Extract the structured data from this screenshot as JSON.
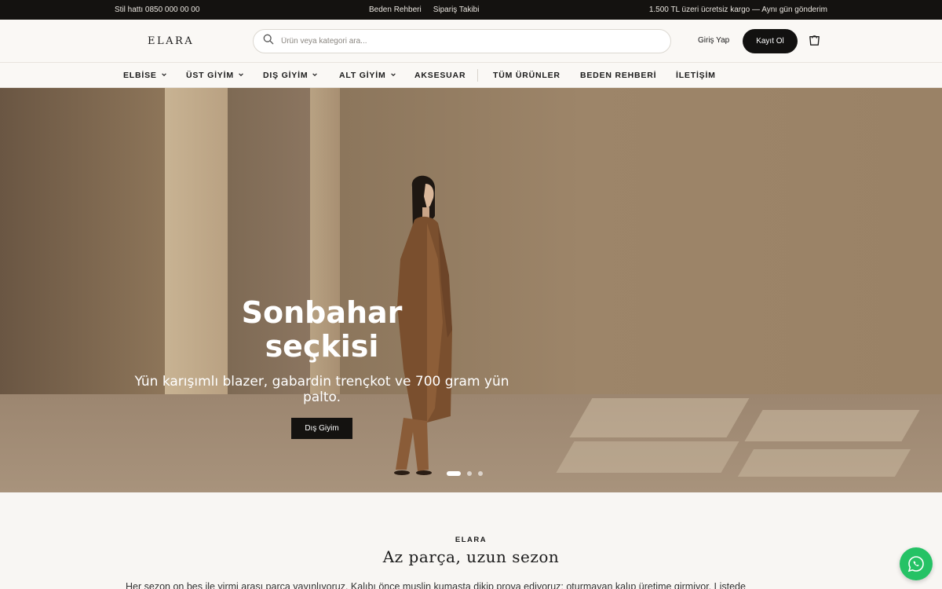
{
  "topbar": {
    "phone": "Stil hattı 0850 000 00 00",
    "links": [
      "Beden Rehberi",
      "Sipariş Takibi"
    ],
    "promo": "1.500 TL üzeri ücretsiz kargo — Aynı gün gönderim"
  },
  "header": {
    "logo": "ELARA",
    "search_placeholder": "Ürün veya kategori ara...",
    "login_label": "Giriş Yap",
    "signup_label": "Kayıt Ol",
    "icons": {
      "search": "search-icon",
      "cart": "shopping-bag-icon"
    }
  },
  "nav": {
    "items": [
      {
        "label": "ELBİSE",
        "dropdown": true
      },
      {
        "label": "ÜST GİYİM",
        "dropdown": true
      },
      {
        "label": "DIŞ GİYİM",
        "dropdown": true
      },
      {
        "label": "ALT GİYİM",
        "dropdown": true
      },
      {
        "label": "AKSESUAR",
        "dropdown": false
      },
      {
        "label": "TÜM ÜRÜNLER",
        "dropdown": false
      },
      {
        "label": "BEDEN REHBERİ",
        "dropdown": false
      },
      {
        "label": "İLETİŞİM",
        "dropdown": false
      }
    ]
  },
  "hero": {
    "title_line1": "Sonbahar",
    "title_line2": "seçkisi",
    "subtitle_line1": "Yün karışımlı blazer, gabardin trençkot ve 700 gram yün",
    "subtitle_line2": "palto.",
    "cta_label": "Dış Giyim",
    "slides_count": 3,
    "active_slide": 1
  },
  "intro": {
    "eyebrow": "ELARA",
    "title": "Az parça, uzun sezon",
    "text": "Her sezon on beş ile yirmi arası parça yayınlıyoruz. Kalıbı önce muslin kumaşta dikip prova ediyoruz; oturmayan kalıp üretime girmiyor. Listede"
  },
  "colors": {
    "topbar_bg": "#141210",
    "page_bg": "#f8f6f3",
    "button_dark": "#121110",
    "whatsapp": "#25c265"
  },
  "floating": {
    "whatsapp": "whatsapp-icon"
  }
}
